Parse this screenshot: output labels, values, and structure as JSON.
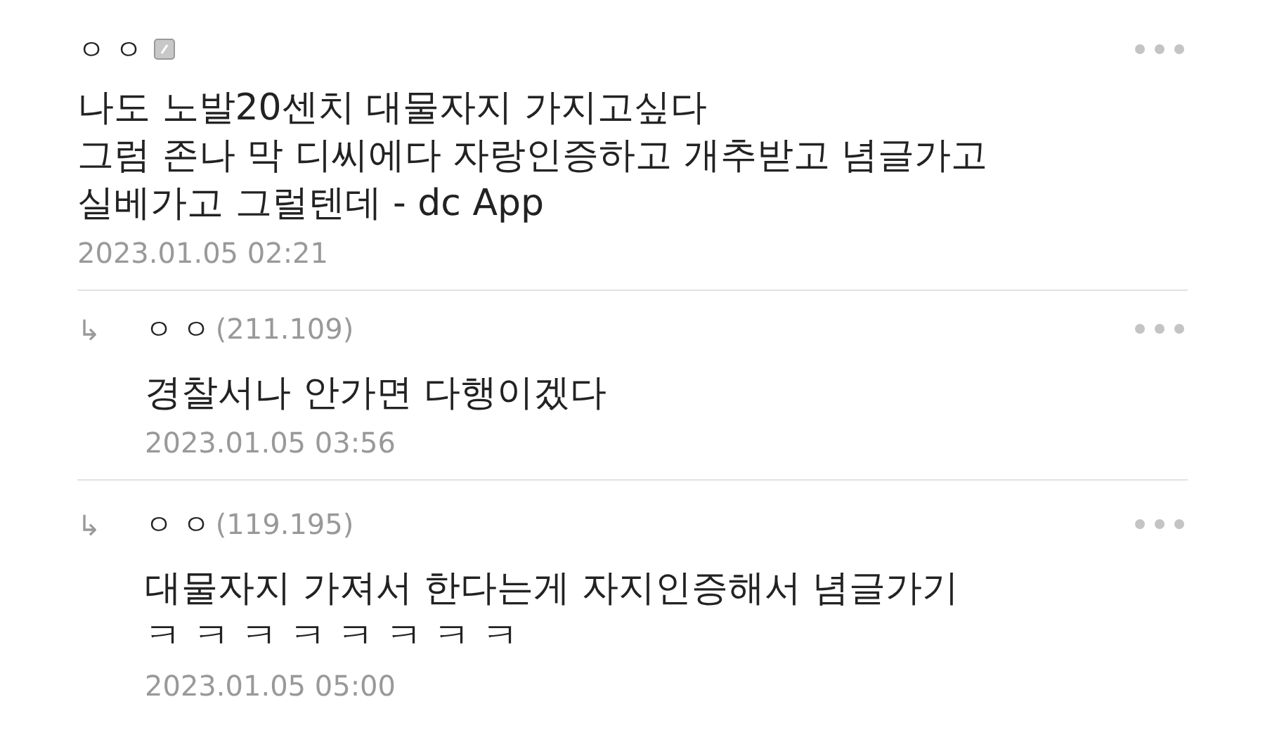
{
  "comments": [
    {
      "kind": "comment",
      "nickname": "ㅇ ㅇ",
      "app_badge": true,
      "body": "나도 노발20센치 대물자지 가지고싶다\n그럼 존나 막 디씨에다 자랑인증하고 개추받고 념글가고\n실베가고 그럴텐데 - dc App",
      "date": "2023.01.05 02:21"
    },
    {
      "kind": "reply",
      "marker": "↳",
      "nickname": "ㅇ ㅇ",
      "ip": "(211.109)",
      "app_badge": false,
      "body": "경찰서나 안가면 다행이겠다",
      "date": "2023.01.05 03:56"
    },
    {
      "kind": "reply",
      "marker": "↳",
      "nickname": "ㅇ ㅇ",
      "ip": "(119.195)",
      "app_badge": false,
      "body": "대물자지 가져서 한다는게 자지인증해서 념글가기\nㅋ ㅋ ㅋ ㅋ ㅋ ㅋ ㅋ ㅋ",
      "date": "2023.01.05 05:00"
    }
  ]
}
